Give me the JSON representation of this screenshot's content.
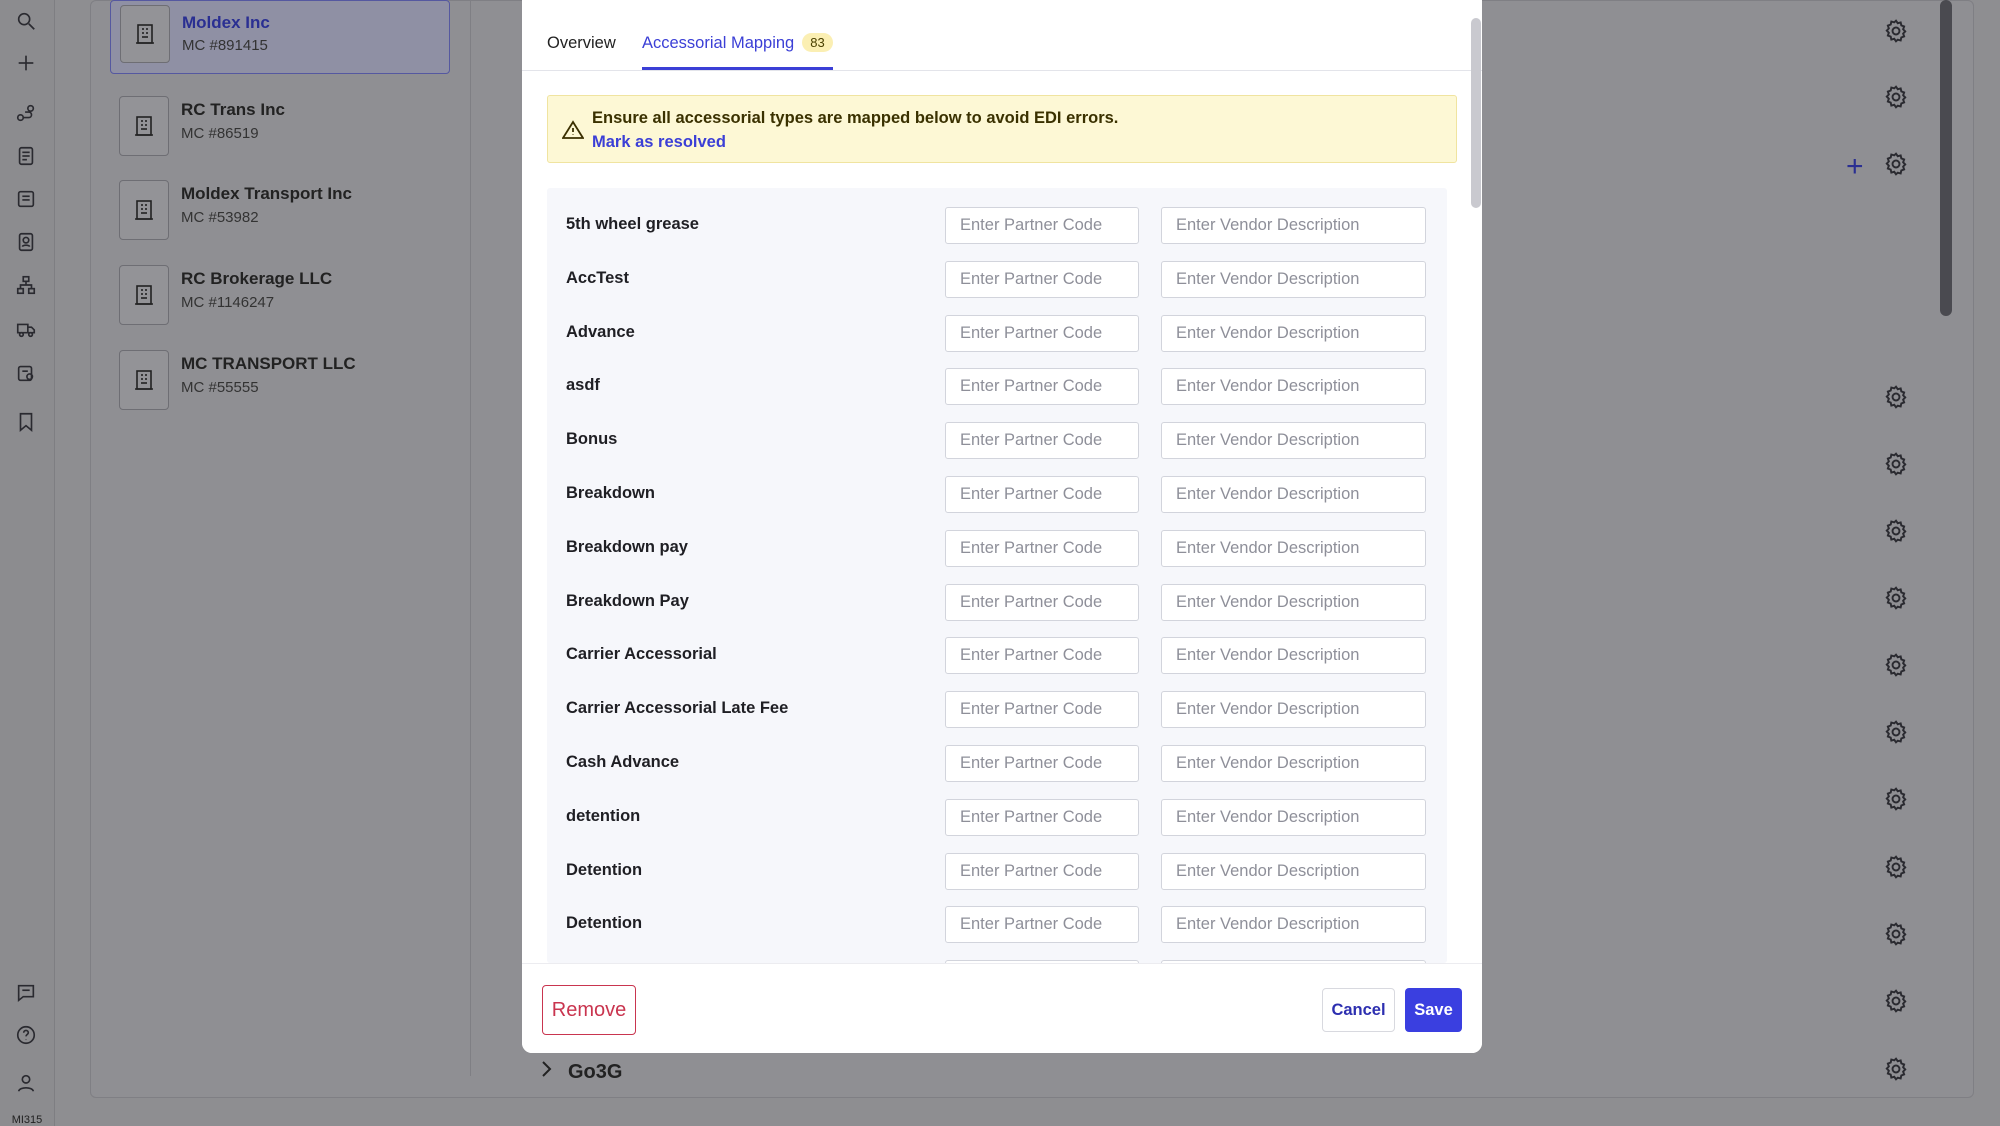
{
  "sidebar": {
    "icons": [
      "search-icon",
      "plus-icon",
      "route-icon",
      "document-icon",
      "invoice-icon",
      "contacts-icon",
      "hierarchy-icon",
      "truck-icon",
      "settings-doc-icon",
      "bookmark-icon",
      "chat-icon",
      "help-icon",
      "user-icon"
    ],
    "user_label": "MI315"
  },
  "companies": [
    {
      "name": "Moldex Inc",
      "mc": "MC #891415",
      "active": true
    },
    {
      "name": "RC Trans Inc",
      "mc": "MC #86519",
      "active": false
    },
    {
      "name": "Moldex Transport Inc",
      "mc": "MC #53982",
      "active": false
    },
    {
      "name": "RC Brokerage LLC",
      "mc": "MC #1146247",
      "active": false
    },
    {
      "name": "MC TRANSPORT LLC",
      "mc": "MC #55555",
      "active": false
    }
  ],
  "background": {
    "group_label": "Go3G"
  },
  "modal": {
    "tabs": [
      {
        "label": "Overview",
        "active": false
      },
      {
        "label": "Accessorial Mapping",
        "active": true,
        "badge": "83"
      }
    ],
    "alert": {
      "message": "Ensure all accessorial types are mapped below to avoid EDI errors.",
      "link": "Mark as resolved"
    },
    "partner_code_placeholder": "Enter Partner Code",
    "vendor_description_placeholder": "Enter Vendor Description",
    "rows": [
      {
        "label": "5th wheel grease",
        "partner_code": "",
        "vendor_description": ""
      },
      {
        "label": "AccTest",
        "partner_code": "",
        "vendor_description": ""
      },
      {
        "label": "Advance",
        "partner_code": "",
        "vendor_description": ""
      },
      {
        "label": "asdf",
        "partner_code": "",
        "vendor_description": ""
      },
      {
        "label": "Bonus",
        "partner_code": "",
        "vendor_description": ""
      },
      {
        "label": "Breakdown",
        "partner_code": "",
        "vendor_description": ""
      },
      {
        "label": "Breakdown pay",
        "partner_code": "",
        "vendor_description": ""
      },
      {
        "label": "Breakdown Pay",
        "partner_code": "",
        "vendor_description": ""
      },
      {
        "label": "Carrier Accessorial",
        "partner_code": "",
        "vendor_description": ""
      },
      {
        "label": "Carrier Accessorial Late Fee",
        "partner_code": "",
        "vendor_description": ""
      },
      {
        "label": "Cash Advance",
        "partner_code": "",
        "vendor_description": ""
      },
      {
        "label": "detention",
        "partner_code": "",
        "vendor_description": ""
      },
      {
        "label": "Detention",
        "partner_code": "",
        "vendor_description": ""
      },
      {
        "label": "Detention",
        "partner_code": "",
        "vendor_description": ""
      },
      {
        "label": "",
        "partner_code": "",
        "vendor_description": ""
      }
    ],
    "buttons": {
      "remove": "Remove",
      "cancel": "Cancel",
      "save": "Save"
    }
  },
  "colors": {
    "accent": "#3b3fd6",
    "danger": "#c9354f",
    "alert_bg": "#fdf8d5",
    "badge_bg": "#fbefb3"
  }
}
